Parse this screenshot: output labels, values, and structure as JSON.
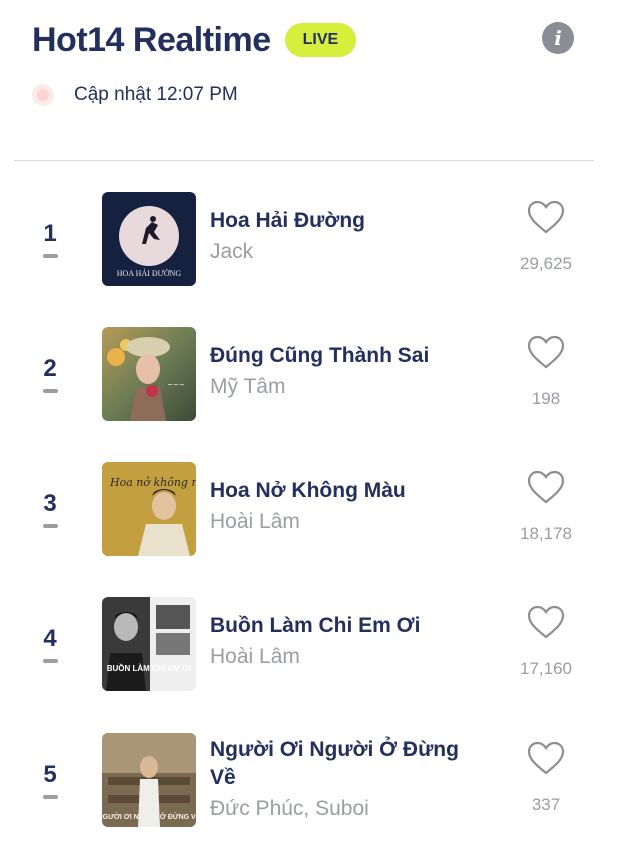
{
  "header": {
    "title": "Hot14 Realtime",
    "live_label": "LIVE",
    "info_icon": "i"
  },
  "status": {
    "updated_text": "Cập nhật 12:07 PM"
  },
  "songs": [
    {
      "rank": "1",
      "title": "Hoa Hải Đường",
      "artist": "Jack",
      "likes": "29,625",
      "cover_text": "HOA HẢI ĐƯỜNG"
    },
    {
      "rank": "2",
      "title": "Đúng Cũng Thành Sai",
      "artist": "Mỹ Tâm",
      "likes": "198",
      "cover_text": ""
    },
    {
      "rank": "3",
      "title": "Hoa Nở Không Màu",
      "artist": "Hoài Lâm",
      "likes": "18,178",
      "cover_text": "Hoa nở không màu"
    },
    {
      "rank": "4",
      "title": "Buồn Làm Chi Em Ơi",
      "artist": "Hoài Lâm",
      "likes": "17,160",
      "cover_text": "BUỒN LÀM CHI EM ƠI"
    },
    {
      "rank": "5",
      "title": "Người Ơi Người Ở Đừng Về",
      "artist": "Đức Phúc, Suboi",
      "likes": "337",
      "cover_text": "NGƯỜI ƠI NGƯỜI Ở ĐỪNG VỀ"
    }
  ],
  "colors": {
    "navy": "#23305e",
    "live_bg": "#d6ee3c",
    "muted": "#9a9da3"
  }
}
